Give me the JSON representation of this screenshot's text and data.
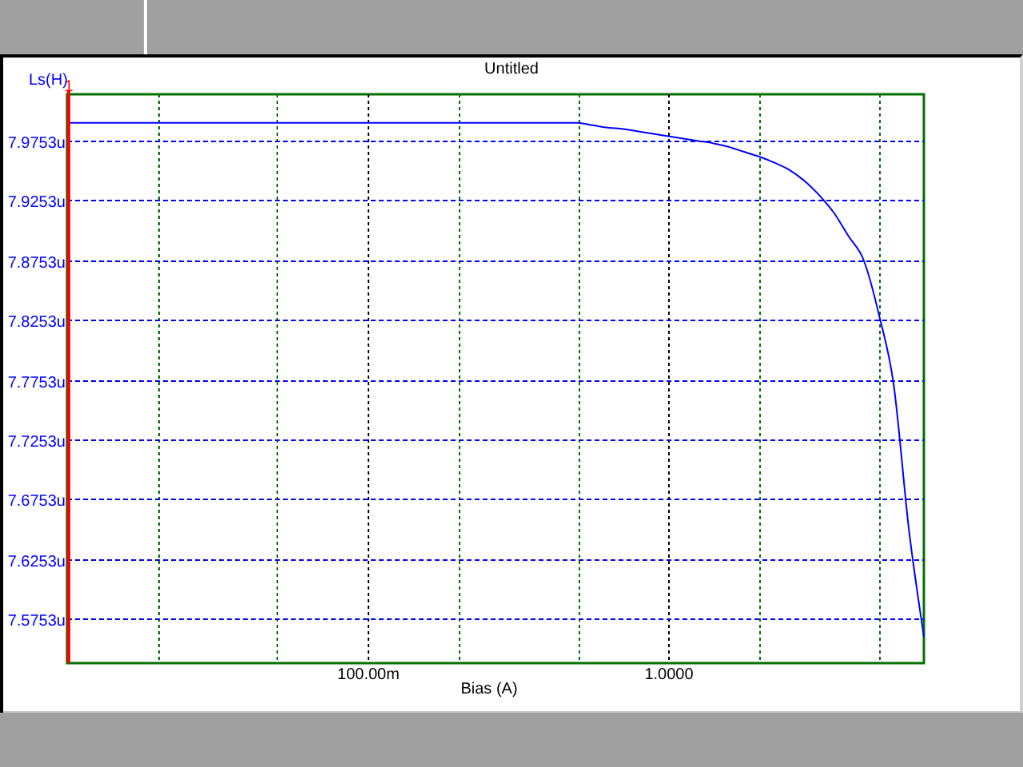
{
  "chart_data": {
    "type": "line",
    "title": "Untitled",
    "xlabel": "Bias (A)",
    "ylabel": "Ls(H)",
    "ylim": [
      7.538,
      8.014
    ],
    "grid": true,
    "yticks": [
      {
        "value": 7.9753,
        "label": "7.9753u"
      },
      {
        "value": 7.9253,
        "label": "7.9253u"
      },
      {
        "value": 7.8753,
        "label": "7.8753u"
      },
      {
        "value": 7.8253,
        "label": "7.8253u"
      },
      {
        "value": 7.7753,
        "label": "7.7753u"
      },
      {
        "value": 7.7253,
        "label": "7.7253u"
      },
      {
        "value": 7.6753,
        "label": "7.6753u"
      },
      {
        "value": 7.6253,
        "label": "7.6253u"
      },
      {
        "value": 7.5753,
        "label": "7.5753u"
      }
    ],
    "categories": [
      null,
      null,
      null,
      null,
      null,
      null,
      null,
      null,
      null,
      null,
      null,
      null,
      null,
      null,
      null,
      null,
      null,
      null,
      null,
      null,
      "100.00m",
      null,
      null,
      null,
      null,
      null,
      null,
      null,
      null,
      null,
      null,
      null,
      null,
      null,
      null,
      null,
      null,
      null,
      null,
      null,
      "1.0000",
      null,
      null,
      null,
      null,
      null,
      null,
      null,
      null,
      null,
      null,
      null,
      null,
      null,
      null,
      null,
      null,
      null
    ],
    "series": [
      {
        "color": "#0000ff",
        "values": [
          7.99,
          7.99,
          7.99,
          7.99,
          7.99,
          7.99,
          7.99,
          7.99,
          7.99,
          7.99,
          7.99,
          7.99,
          7.99,
          7.99,
          7.99,
          7.99,
          7.99,
          7.99,
          7.99,
          7.99,
          7.99,
          7.99,
          7.99,
          7.99,
          7.99,
          7.99,
          7.99,
          7.99,
          7.99,
          7.99,
          7.99,
          7.99,
          7.99,
          7.99,
          7.99,
          7.988,
          7.986,
          7.985,
          7.983,
          7.981,
          7.979,
          7.977,
          7.975,
          7.973,
          7.97,
          7.966,
          7.962,
          7.957,
          7.951,
          7.942,
          7.93,
          7.915,
          7.895,
          7.875,
          7.83,
          7.77,
          7.65,
          7.56
        ]
      }
    ],
    "annotations": [
      "1"
    ]
  }
}
